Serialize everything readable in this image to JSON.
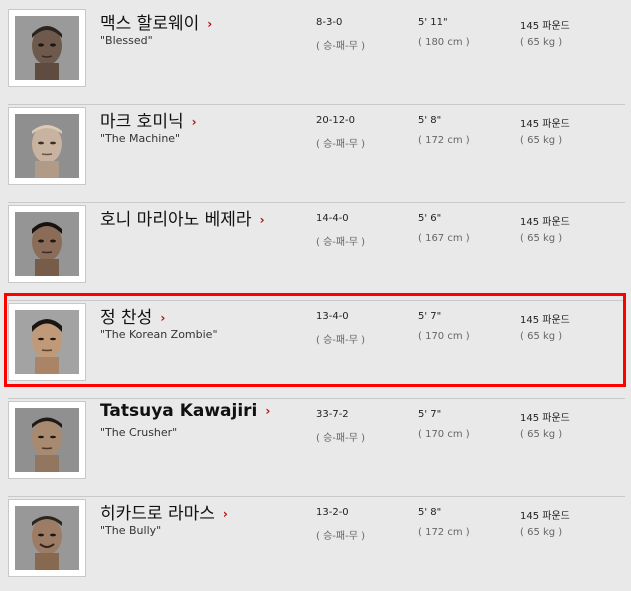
{
  "fighters": [
    {
      "name": "맥스 할로웨이",
      "nickname": "\"Blessed\"",
      "record": "8-3-0",
      "record_label": "( 승-패-무 )",
      "height": "5' 11\"",
      "height_cm": "( 180 cm )",
      "weight": "145 파운드",
      "weight_kg": "( 65 kg )",
      "name_style": "ko"
    },
    {
      "name": "마크 호미닉",
      "nickname": "\"The Machine\"",
      "record": "20-12-0",
      "record_label": "( 승-패-무 )",
      "height": "5' 8\"",
      "height_cm": "( 172 cm )",
      "weight": "145 파운드",
      "weight_kg": "( 65 kg )",
      "name_style": "ko"
    },
    {
      "name": "호니 마리아노 베제라",
      "nickname": "",
      "record": "14-4-0",
      "record_label": "( 승-패-무 )",
      "height": "5' 6\"",
      "height_cm": "( 167 cm )",
      "weight": "145 파운드",
      "weight_kg": "( 65 kg )",
      "name_style": "ko"
    },
    {
      "name": "정 찬성",
      "nickname": "\"The Korean Zombie\"",
      "record": "13-4-0",
      "record_label": "( 승-패-무 )",
      "height": "5' 7\"",
      "height_cm": "( 170 cm )",
      "weight": "145 파운드",
      "weight_kg": "( 65 kg )",
      "name_style": "ko"
    },
    {
      "name": "Tatsuya Kawajiri",
      "nickname": "\"The Crusher\"",
      "record": "33-7-2",
      "record_label": "( 승-패-무 )",
      "height": "5' 7\"",
      "height_cm": "( 170 cm )",
      "weight": "145 파운드",
      "weight_kg": "( 65 kg )",
      "name_style": "en"
    },
    {
      "name": "히카드로 라마스",
      "nickname": "\"The Bully\"",
      "record": "13-2-0",
      "record_label": "( 승-패-무 )",
      "height": "5' 8\"",
      "height_cm": "( 172 cm )",
      "weight": "145 파운드",
      "weight_kg": "( 65 kg )",
      "name_style": "ko"
    }
  ],
  "arrow_glyph": "›",
  "highlight_color": "#ff0000",
  "accent_color": "#b40d0d"
}
